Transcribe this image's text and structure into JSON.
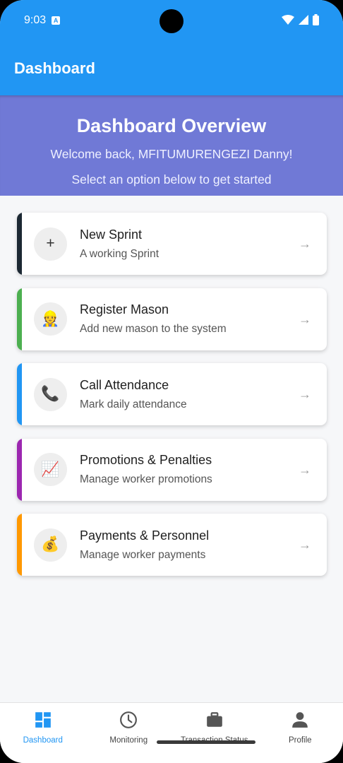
{
  "status_bar": {
    "time": "9:03",
    "notification_icon": "a-icon"
  },
  "app_bar": {
    "title": "Dashboard"
  },
  "overview": {
    "title": "Dashboard Overview",
    "welcome": "Welcome back, MFITUMURENGEZI Danny!",
    "prompt": "Select an option below to get started"
  },
  "cards": [
    {
      "title": "New Sprint",
      "subtitle": "A working Sprint",
      "icon": "+",
      "icon_name": "plus-icon",
      "accent": "#1c2833",
      "arrow": "→"
    },
    {
      "title": "Register Mason",
      "subtitle": "Add new mason to the system",
      "icon": "👷",
      "icon_name": "construction-worker-icon",
      "accent": "#4caf50",
      "arrow": "→"
    },
    {
      "title": "Call Attendance",
      "subtitle": "Mark daily attendance",
      "icon": "📞",
      "icon_name": "phone-icon",
      "accent": "#2196f3",
      "arrow": "→"
    },
    {
      "title": "Promotions & Penalties",
      "subtitle": "Manage worker promotions",
      "icon": "📈",
      "icon_name": "chart-increasing-icon",
      "accent": "#9c27b0",
      "arrow": "→"
    },
    {
      "title": "Payments & Personnel",
      "subtitle": "Manage worker payments",
      "icon": "💰",
      "icon_name": "money-bag-icon",
      "accent": "#ff9800",
      "arrow": "→"
    }
  ],
  "bottom_nav": [
    {
      "label": "Dashboard",
      "icon": "dashboard-icon",
      "active": true
    },
    {
      "label": "Monitoring",
      "icon": "clock-icon",
      "active": false
    },
    {
      "label": "Transaction Status",
      "icon": "briefcase-icon",
      "active": false
    },
    {
      "label": "Profile",
      "icon": "person-icon",
      "active": false
    }
  ],
  "colors": {
    "primary": "#2196f3",
    "banner": "#7079d6",
    "background": "#f6f7f9"
  }
}
